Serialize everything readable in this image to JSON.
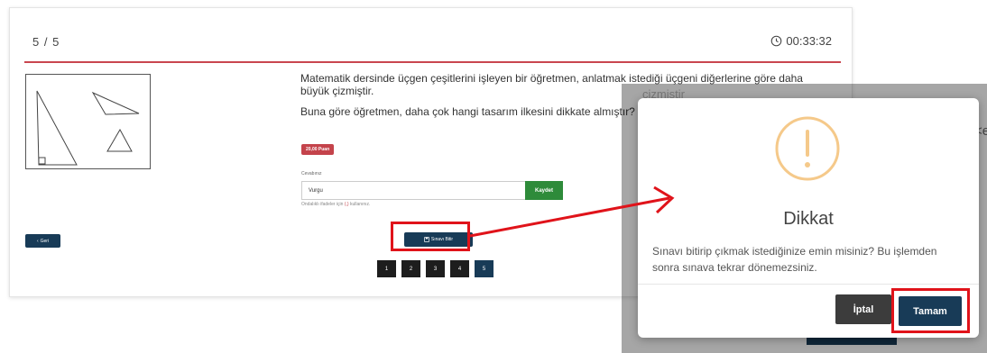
{
  "exam": {
    "counter": "5 / 5",
    "timer": "00:33:32",
    "question_line1": "Matematik dersinde üçgen çeşitlerini işleyen bir öğretmen, anlatmak istediği üçgeni diğerlerine göre daha büyük çizmiştir.",
    "question_line2": "Buna göre öğretmen, daha çok hangi tasarım ilkesini dikkate almıştır?",
    "points_badge": "20,00 Puan",
    "answer_label": "Cevabınız",
    "answer_value": "Vurgu",
    "save_label": "Kaydet",
    "hint_prefix": "Ondalıklı ifadeler için",
    "hint_symbol": "(,)",
    "hint_suffix": "kullanınız.",
    "back_label": "Geri",
    "finish_label": "Sınavı Bitir",
    "pages": [
      "1",
      "2",
      "3",
      "4",
      "5"
    ],
    "active_page": "5"
  },
  "background": {
    "word_fragment": "çizmiştir",
    "right_fragment": "<e"
  },
  "modal": {
    "title": "Dikkat",
    "message": "Sınavı bitirip çıkmak istediğinize emin misiniz? Bu işlemden sonra sınava tekrar dönemezsiniz.",
    "cancel_label": "İptal",
    "ok_label": "Tamam"
  },
  "colors": {
    "accent_red": "#c4434b",
    "navy": "#183b57",
    "green": "#2e8b3a",
    "highlight": "#e0131a",
    "warning": "#f5c98a"
  },
  "icons": {
    "timer": "clock-icon",
    "back": "chevron-left-icon",
    "finish": "save-icon",
    "warning": "exclamation-circle-icon"
  }
}
